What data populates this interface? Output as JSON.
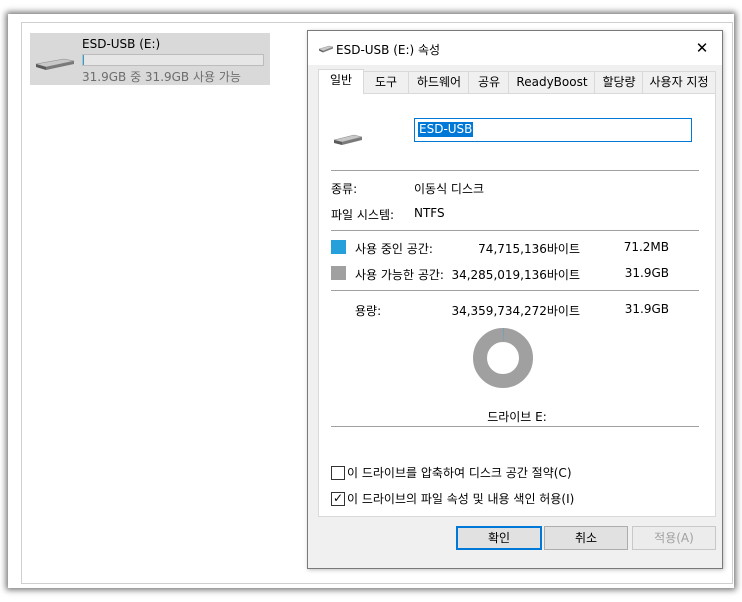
{
  "explorer": {
    "drive_name": "ESD-USB (E:)",
    "drive_free_text": "31.9GB 중 31.9GB 사용 가능",
    "usage_fraction": 0.002
  },
  "dialog": {
    "title": "ESD-USB (E:) 속성",
    "tabs": [
      {
        "label": "일반",
        "active": true
      },
      {
        "label": "도구"
      },
      {
        "label": "하드웨어"
      },
      {
        "label": "공유"
      },
      {
        "label": "ReadyBoost"
      },
      {
        "label": "할당량"
      },
      {
        "label": "사용자 지정"
      }
    ],
    "volume_name": "ESD-USB",
    "type_label": "종류:",
    "type_value": "이동식 디스크",
    "fs_label": "파일 시스템:",
    "fs_value": "NTFS",
    "used": {
      "label": "사용 중인 공간:",
      "bytes": "74,715,136바이트",
      "size": "71.2MB",
      "color": "#26a0da"
    },
    "free": {
      "label": "사용 가능한 공간:",
      "bytes": "34,285,019,136바이트",
      "size": "31.9GB",
      "color": "#a0a0a0"
    },
    "capacity": {
      "label": "용량:",
      "bytes": "34,359,734,272바이트",
      "size": "31.9GB"
    },
    "drive_caption": "드라이브 E:",
    "compress_label": "이 드라이브를 압축하여 디스크 공간 절약(C)",
    "compress_checked": false,
    "index_label": "이 드라이브의 파일 속성 및 내용 색인 허용(I)",
    "index_checked": true,
    "buttons": {
      "ok": "확인",
      "cancel": "취소",
      "apply": "적용(A)"
    },
    "check_mark": "✓"
  }
}
